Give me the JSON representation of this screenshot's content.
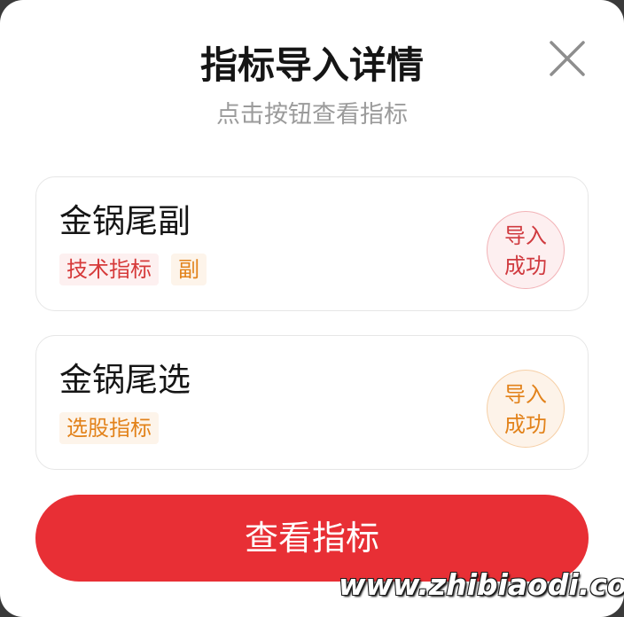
{
  "dialog": {
    "title": "指标导入详情",
    "subtitle": "点击按钮查看指标",
    "close_icon": "close-icon"
  },
  "indicators": [
    {
      "name": "金锅尾副",
      "tags": [
        "技术指标",
        "副"
      ],
      "status_line1": "导入",
      "status_line2": "成功",
      "status_color": "#d03a3f"
    },
    {
      "name": "金锅尾选",
      "tags": [
        "选股指标"
      ],
      "status_line1": "导入",
      "status_line2": "成功",
      "status_color": "#e2821a"
    }
  ],
  "actions": {
    "view_label": "查看指标"
  },
  "watermark": "www.zhibiaodi.com",
  "colors": {
    "primary": "#e82f35",
    "tag_red": "#d63a3a",
    "tag_orange": "#e2821a"
  }
}
